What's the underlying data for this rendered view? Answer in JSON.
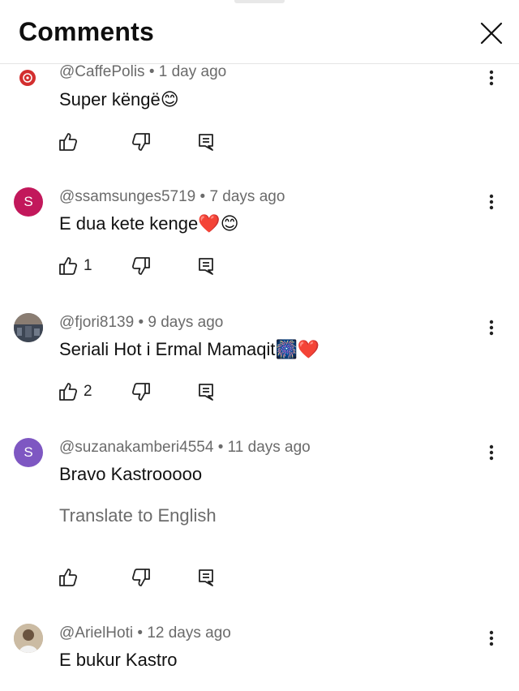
{
  "header": {
    "title": "Comments",
    "close_icon": "close-icon"
  },
  "comments": [
    {
      "handle": "@CaffePolis",
      "time": "1 day ago",
      "text": "Super këngë",
      "emoji": "😊",
      "likes": "",
      "avatar_color": "#d32f2f"
    },
    {
      "handle": "@ssamsunges5719",
      "time": "7 days ago",
      "text": "E dua kete kenge",
      "emoji": "❤️😊",
      "likes": "1",
      "avatar_letter": "S",
      "avatar_color": "#c2185b"
    },
    {
      "handle": "@fjori8139",
      "time": "9 days ago",
      "text": "Seriali Hot i Ermal Mamaqit",
      "emoji": "🎆❤️",
      "likes": "2",
      "avatar_color": "#5f6a78"
    },
    {
      "handle": "@suzanakamberi4554",
      "time": "11 days ago",
      "text": "Bravo Kastrooooo",
      "emoji": "",
      "likes": "",
      "translate": "Translate to English",
      "avatar_letter": "S",
      "avatar_color": "#7e57c2"
    },
    {
      "handle": "@ArielHoti",
      "time": "12 days ago",
      "text": "E bukur Kastro",
      "emoji": "",
      "likes": "",
      "avatar_color": "#b8a48a"
    }
  ],
  "colors": {
    "meta_text": "#6b6b6b",
    "body_text": "#111111",
    "divider": "#e5e5e5"
  }
}
